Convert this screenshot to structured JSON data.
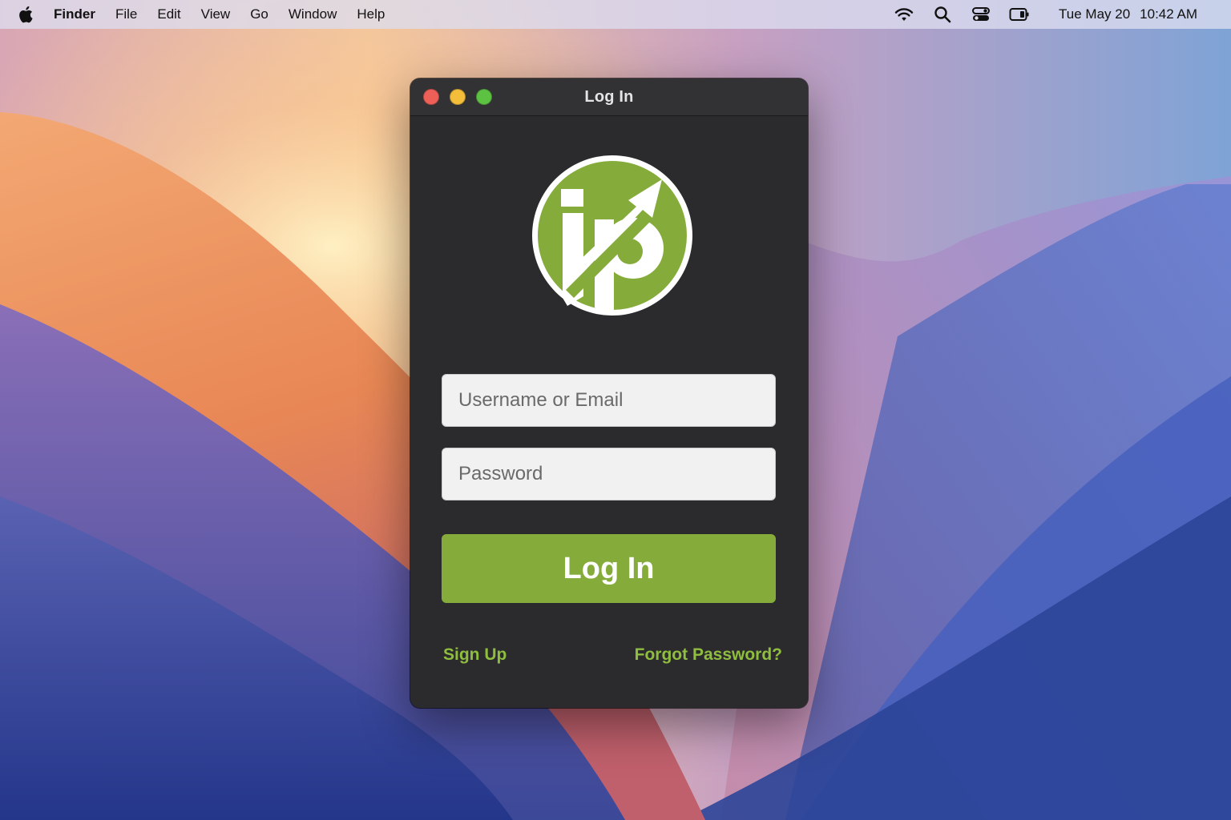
{
  "menubar": {
    "apple_icon": "apple-icon",
    "app_name": "Finder",
    "items": [
      "File",
      "Edit",
      "View",
      "Go",
      "Window",
      "Help"
    ],
    "status_icons": [
      "wifi-icon",
      "search-icon",
      "control-center-icon",
      "battery-icon"
    ],
    "date": "Tue May 20",
    "time": "10:42 AM"
  },
  "window": {
    "title": "Log In",
    "logo": {
      "icon": "jp-logo-icon",
      "text": "jp",
      "color": "#85ac3a"
    },
    "username": {
      "placeholder": "Username or Email",
      "value": ""
    },
    "password": {
      "placeholder": "Password",
      "value": ""
    },
    "login_label": "Log In",
    "signup_label": "Sign Up",
    "forgot_label": "Forgot Password?"
  },
  "colors": {
    "accent": "#85ac3a",
    "link": "#8fbd3e",
    "window_bg": "#2b2b2d"
  }
}
